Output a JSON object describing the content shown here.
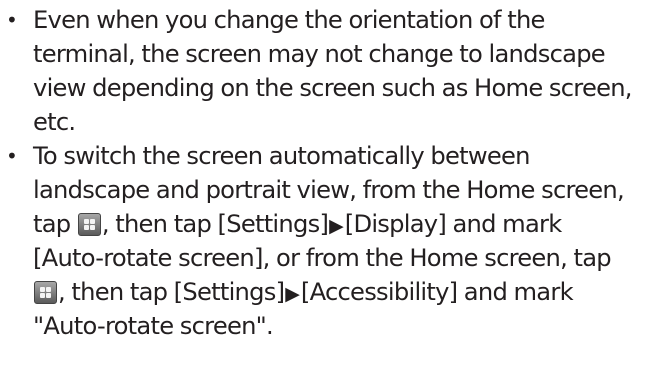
{
  "notes": [
    {
      "bullet": "•",
      "lines": [
        "Even when you change the orientation of the",
        "terminal, the screen may not change to landscape",
        "view depending on the screen such as Home screen,",
        "etc."
      ]
    },
    {
      "bullet": "•",
      "lines": {
        "l1": "To switch the screen automatically between",
        "l2": "landscape and portrait view, from the Home screen,",
        "l3_before_icon": "tap ",
        "l3_after_icon": ", then tap [Settings]",
        "arrow1": "▶",
        "l3_end": "[Display] and mark",
        "l4": "[Auto-rotate screen], or from the Home screen, tap",
        "l5_after_icon": ", then tap [Settings]",
        "arrow2": "▶",
        "l5_end": "[Accessibility] and mark",
        "l6": "\"Auto-rotate screen\"."
      }
    }
  ],
  "icons": {
    "apps_button": "apps-grid-icon"
  }
}
